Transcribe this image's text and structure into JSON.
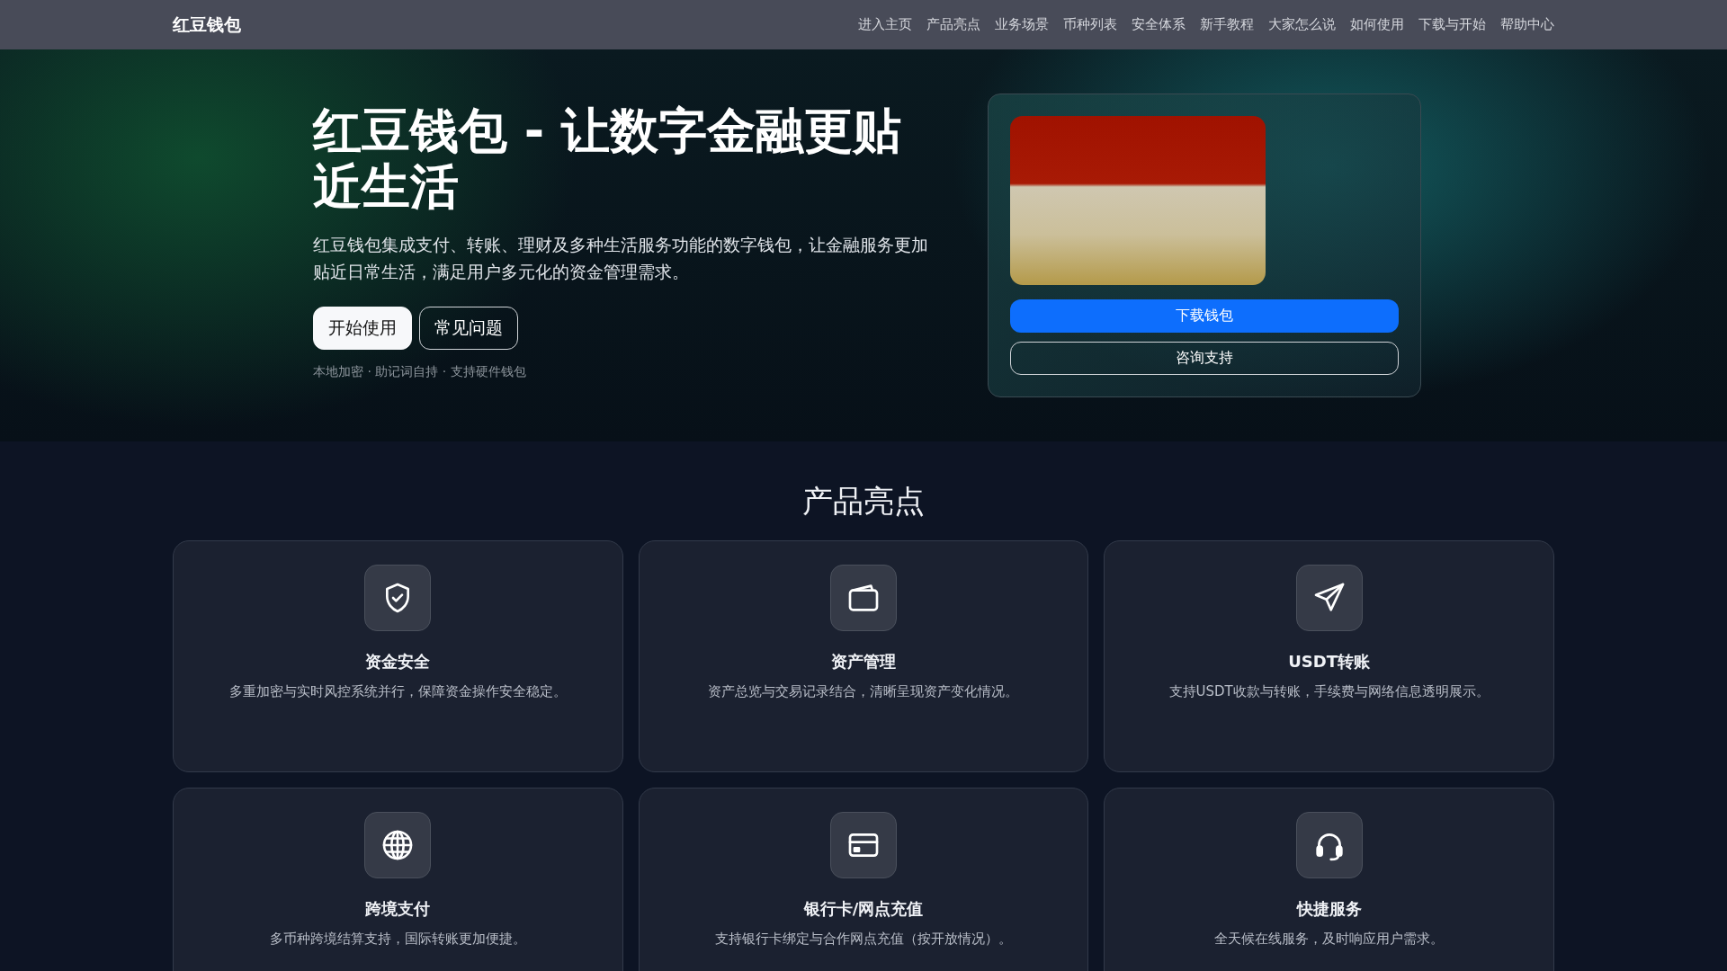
{
  "nav": {
    "brand": "红豆钱包",
    "links": [
      "进入主页",
      "产品亮点",
      "业务场景",
      "币种列表",
      "安全体系",
      "新手教程",
      "大家怎么说",
      "如何使用",
      "下载与开始",
      "帮助中心"
    ]
  },
  "hero": {
    "title": "红豆钱包 - 让数字金融更贴近生活",
    "description": "红豆钱包集成支付、转账、理财及多种生活服务功能的数字钱包，让金融服务更加贴近日常生活，满足用户多元化的资金管理需求。",
    "buttons": [
      {
        "label": "开始使用",
        "kind": "primary"
      },
      {
        "label": "常见问题",
        "kind": "outline"
      }
    ],
    "note": "本地加密 · 助记词自持 · 支持硬件钱包"
  },
  "download_card": {
    "buttons": [
      {
        "label": "下载钱包",
        "kind": "primary"
      },
      {
        "label": "咨询支持",
        "kind": "outline"
      }
    ]
  },
  "features": {
    "title": "产品亮点",
    "items": [
      {
        "title": "资金安全",
        "text": "多重加密与实时风控系统并行，保障资金操作安全稳定。"
      },
      {
        "title": "资产管理",
        "text": "资产总览与交易记录结合，清晰呈现资产变化情况。"
      },
      {
        "title": "USDT转账",
        "text": "支持USDT收款与转账，手续费与网络信息透明展示。"
      },
      {
        "title": "跨境支付",
        "text": "多币种跨境结算支持，国际转账更加便捷。"
      },
      {
        "title": "银行卡/网点充值",
        "text": "支持银行卡绑定与合作网点充值（按开放情况）。"
      },
      {
        "title": "快捷服务",
        "text": "全天候在线服务，及时响应用户需求。"
      }
    ]
  }
}
